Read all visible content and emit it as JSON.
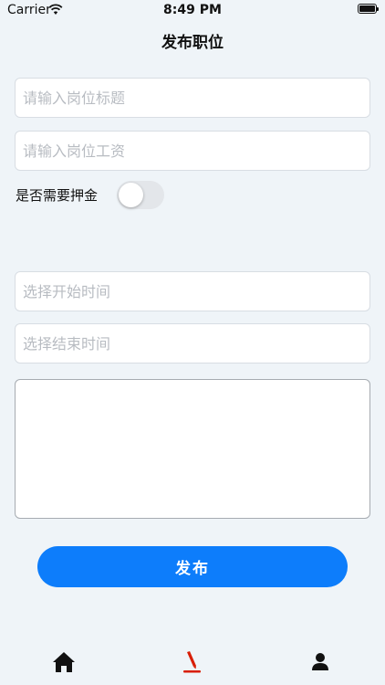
{
  "status_bar": {
    "carrier": "Carrier",
    "time": "8:49 PM"
  },
  "nav": {
    "title": "发布职位"
  },
  "form": {
    "title_placeholder": "请输入岗位标题",
    "salary_placeholder": "请输入岗位工资",
    "deposit_label": "是否需要押金",
    "deposit_required": false,
    "start_placeholder": "选择开始时间",
    "end_placeholder": "选择结束时间",
    "description_value": ""
  },
  "actions": {
    "publish_label": "发布"
  },
  "tab_bar": {
    "items": [
      {
        "icon": "home-icon",
        "active": false
      },
      {
        "icon": "pen-icon",
        "active": true
      },
      {
        "icon": "person-icon",
        "active": false
      }
    ]
  },
  "colors": {
    "accent": "#0d7dfb",
    "active_tab": "#d81e06",
    "background": "#eff4f8"
  }
}
